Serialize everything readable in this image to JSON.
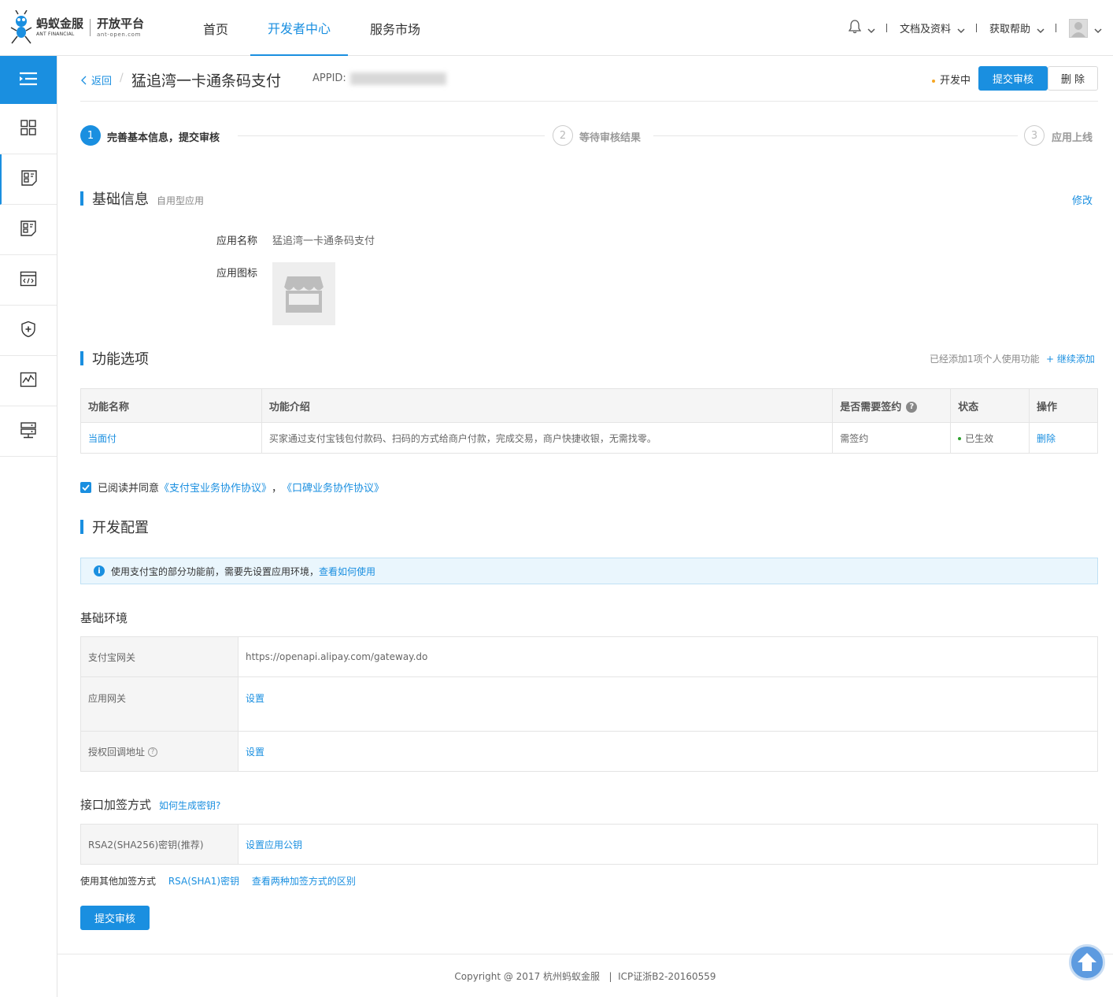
{
  "header": {
    "logo": {
      "brand_cn": "蚂蚁金服",
      "brand_en": "ANT FINANCIAL",
      "platform_cn": "开放平台",
      "platform_en": "ant-open.com"
    },
    "nav": [
      {
        "label": "首页",
        "active": false
      },
      {
        "label": "开发者中心",
        "active": true
      },
      {
        "label": "服务市场",
        "active": false
      }
    ],
    "right": {
      "docs": "文档及资料",
      "help": "获取帮助"
    }
  },
  "sidebar": {
    "items": [
      {
        "icon": "menu-icon"
      },
      {
        "icon": "grid-icon"
      },
      {
        "icon": "app-card-icon",
        "active": true
      },
      {
        "icon": "app-card-icon"
      },
      {
        "icon": "code-window-icon"
      },
      {
        "icon": "shield-icon"
      },
      {
        "icon": "chart-icon"
      },
      {
        "icon": "server-icon"
      }
    ]
  },
  "page_header": {
    "back": "返回",
    "crumb_sep": "/",
    "title": "猛追湾一卡通条码支付",
    "appid_label": "APPID:",
    "appid_value": "2017090600000000",
    "status": "开发中",
    "submit": "提交审核",
    "delete": "删 除"
  },
  "steps": [
    {
      "num": "1",
      "label": "完善基本信息，提交审核",
      "done": true
    },
    {
      "num": "2",
      "label": "等待审核结果",
      "done": false
    },
    {
      "num": "3",
      "label": "应用上线",
      "done": false
    }
  ],
  "basic_info": {
    "title": "基础信息",
    "subtitle": "自用型应用",
    "edit": "修改",
    "name_label": "应用名称",
    "name_value": "猛追湾一卡通条码支付",
    "icon_label": "应用图标"
  },
  "features": {
    "title": "功能选项",
    "added_note": "已经添加1项个人使用功能",
    "add_more": "+ 继续添加",
    "columns": [
      "功能名称",
      "功能介绍",
      "是否需要签约",
      "状态",
      "操作"
    ],
    "rows": [
      {
        "name": "当面付",
        "desc": "买家通过支付宝钱包付款码、扫码的方式给商户付款，完成交易，商户快捷收银，无需找零。",
        "sign": "需签约",
        "status": "已生效",
        "action": "删除"
      }
    ]
  },
  "agreement": {
    "text": "已阅读并同意",
    "link1": "《支付宝业务协作协议》",
    "comma": "，",
    "link2": "《口碑业务协作协议》"
  },
  "dev_config": {
    "title": "开发配置",
    "info_text": "使用支付宝的部分功能前，需要先设置应用环境，",
    "info_link": "查看如何使用",
    "env_title": "基础环境",
    "env_rows": [
      {
        "label": "支付宝网关",
        "value": "https://openapi.alipay.com/gateway.do",
        "is_link": false
      },
      {
        "label": "应用网关",
        "value": "设置",
        "is_link": true
      },
      {
        "label": "授权回调地址",
        "value": "设置",
        "is_link": true,
        "help": "?"
      }
    ],
    "sign_title": "接口加签方式",
    "sign_help": "如何生成密钥?",
    "sign_row": {
      "label": "RSA2(SHA256)密钥(推荐)",
      "value": "设置应用公钥"
    },
    "other_label": "使用其他加签方式",
    "other_link1": "RSA(SHA1)密钥",
    "other_link2": "查看两种加签方式的区别",
    "submit": "提交审核"
  },
  "footer": {
    "text": "Copyright @ 2017 杭州蚂蚁金服   |  ICP证浙B2-20160559"
  },
  "colors": {
    "primary": "#1a8fe0",
    "status_dev": "#f5a623",
    "status_ok": "#2ca02c"
  }
}
